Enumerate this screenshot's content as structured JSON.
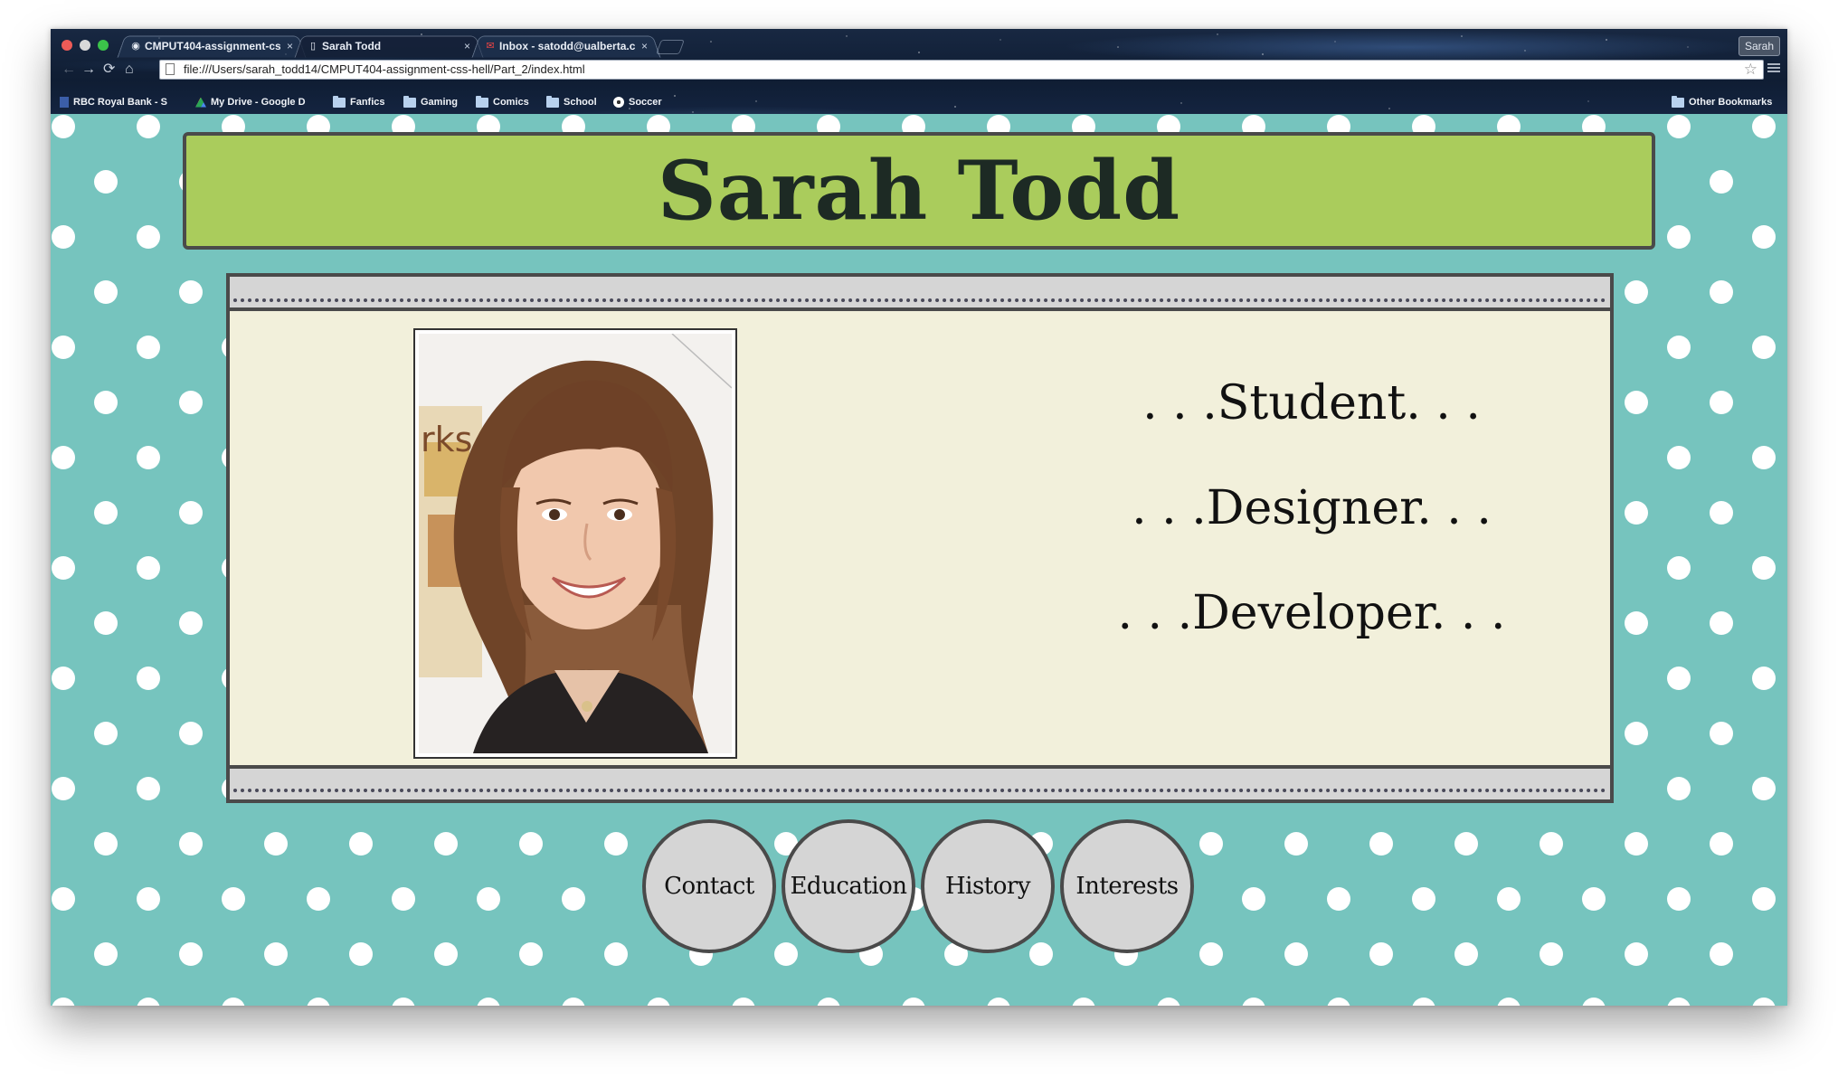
{
  "browser": {
    "tabs": [
      {
        "title": "CMPUT404-assignment-cs",
        "icon": "github-icon",
        "active": false
      },
      {
        "title": "Sarah Todd",
        "icon": "page-icon",
        "active": true
      },
      {
        "title": "Inbox - satodd@ualberta.c",
        "icon": "gmail-icon",
        "active": false
      }
    ],
    "profile": "Sarah",
    "url": "file:///Users/sarah_todd14/CMPUT404-assignment-css-hell/Part_2/index.html",
    "bookmarks": [
      {
        "label": "RBC Royal Bank - S",
        "icon": "bank-icon"
      },
      {
        "label": "My Drive - Google D",
        "icon": "drive-icon"
      },
      {
        "label": "Fanfics",
        "icon": "folder-icon"
      },
      {
        "label": "Gaming",
        "icon": "folder-icon"
      },
      {
        "label": "Comics",
        "icon": "folder-icon"
      },
      {
        "label": "School",
        "icon": "folder-icon"
      },
      {
        "label": "Soccer",
        "icon": "soccer-icon"
      },
      {
        "label": "Other Bookmarks",
        "icon": "folder-icon"
      }
    ]
  },
  "page": {
    "title": "Sarah Todd",
    "roles": [
      ". . .Student. . .",
      ". . .Designer. . .",
      ". . .Developer. . ."
    ],
    "nav": [
      "Contact",
      "Education",
      "History",
      "Interests"
    ]
  },
  "colors": {
    "background": "#76c4be",
    "header": "#aacc5c",
    "card": "#f2f0db",
    "stripe": "#d5d5d5",
    "border": "#4a4a4a",
    "dots": "#ffffff"
  }
}
